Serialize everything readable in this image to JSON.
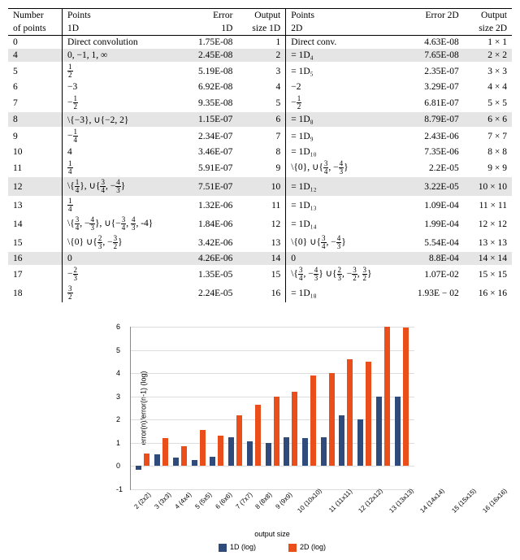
{
  "table": {
    "headers": {
      "c1a": "Number",
      "c1b": "of points",
      "c2": "Points",
      "c2b": "1D",
      "c3": "Error",
      "c3b": "1D",
      "c4": "Output",
      "c4b": "size 1D",
      "c5": "Points",
      "c5b": "2D",
      "c6": "Error 2D",
      "c7": "Output",
      "c7b": "size 2D"
    },
    "rows": [
      {
        "n": "0",
        "p1d": "Direct convolution",
        "e1d": "1.75E-08",
        "o1d": "1",
        "p2d": "Direct conv.",
        "e2d": "4.63E-08",
        "o2d": "1 × 1",
        "shade": false
      },
      {
        "n": "4",
        "p1d": "0, −1, 1, ∞",
        "e1d": "2.45E-08",
        "o1d": "2",
        "p2d": "= 1D₄",
        "e2d": "7.65E-08",
        "o2d": "2 × 2",
        "shade": true
      },
      {
        "n": "5",
        "p1d": "f:1/2",
        "e1d": "5.19E-08",
        "o1d": "3",
        "p2d": "= 1D₅",
        "e2d": "2.35E-07",
        "o2d": "3 × 3",
        "shade": false
      },
      {
        "n": "6",
        "p1d": "−3",
        "e1d": "6.92E-08",
        "o1d": "4",
        "p2d": "−2",
        "e2d": "3.29E-07",
        "o2d": "4 × 4",
        "shade": false
      },
      {
        "n": "7",
        "p1d": "f:-1/2",
        "e1d": "9.35E-08",
        "o1d": "5",
        "p2d": "f:-1/2",
        "e2d": "6.81E-07",
        "o2d": "5 × 5",
        "shade": false
      },
      {
        "n": "8",
        "p1d": "\\{−3}, ∪{−2, 2}",
        "e1d": "1.15E-07",
        "o1d": "6",
        "p2d": "= 1D₈",
        "e2d": "8.79E-07",
        "o2d": "6 × 6",
        "shade": true
      },
      {
        "n": "9",
        "p1d": "f:-1/4",
        "e1d": "2.34E-07",
        "o1d": "7",
        "p2d": "= 1D₉",
        "e2d": "2.43E-06",
        "o2d": "7 × 7",
        "shade": false
      },
      {
        "n": "10",
        "p1d": "4",
        "e1d": "3.46E-07",
        "o1d": "8",
        "p2d": "= 1D₁₀",
        "e2d": "7.35E-06",
        "o2d": "8 × 8",
        "shade": false
      },
      {
        "n": "11",
        "p1d": "f:1/4",
        "e1d": "5.91E-07",
        "o1d": "9",
        "p2d": "s:\\{0}, ∪{3/4, -4/3}",
        "e2d": "2.2E-05",
        "o2d": "9 × 9",
        "shade": false
      },
      {
        "n": "12",
        "p1d": "s:\\{1/4}, ∪{3/4, -4/3}",
        "e1d": "7.51E-07",
        "o1d": "10",
        "p2d": "= 1D₁₂",
        "e2d": "3.22E-05",
        "o2d": "10 × 10",
        "shade": true
      },
      {
        "n": "13",
        "p1d": "f:1/4",
        "e1d": "1.32E-06",
        "o1d": "11",
        "p2d": "= 1D₁₃",
        "e2d": "1.09E-04",
        "o2d": "11 × 11",
        "shade": false
      },
      {
        "n": "14",
        "p1d": "s:\\{3/4, -4/3}, ∪{-3/4, 4/3, -4}",
        "e1d": "1.84E-06",
        "o1d": "12",
        "p2d": "= 1D₁₄",
        "e2d": "1.99E-04",
        "o2d": "12 × 12",
        "shade": false
      },
      {
        "n": "15",
        "p1d": "s:\\{0} ∪{2/3, -3/2}",
        "e1d": "3.42E-06",
        "o1d": "13",
        "p2d": "s:\\{0} ∪{3/4, -4/3}",
        "e2d": "5.54E-04",
        "o2d": "13 × 13",
        "shade": false
      },
      {
        "n": "16",
        "p1d": "0",
        "e1d": "4.26E-06",
        "o1d": "14",
        "p2d": "0",
        "e2d": "8.8E-04",
        "o2d": "14 × 14",
        "shade": true
      },
      {
        "n": "17",
        "p1d": "f:-2/3",
        "e1d": "1.35E-05",
        "o1d": "15",
        "p2d": "s:\\{3/4, -4/3} ∪{2/3, -3/2, 3/2}",
        "e2d": "1.07E-02",
        "o2d": "15 × 15",
        "shade": false
      },
      {
        "n": "18",
        "p1d": "f:3/2",
        "e1d": "2.24E-05",
        "o1d": "16",
        "p2d": "= 1D₁₈",
        "e2d": "1.93E − 02",
        "o2d": "16 × 16",
        "shade": false
      }
    ]
  },
  "chart_data": {
    "type": "bar",
    "title": "",
    "xlabel": "output size",
    "ylabel": "error(n)/error(n-1) (log)",
    "ylim": [
      -1,
      6
    ],
    "categories": [
      "2 (2x2)",
      "3 (3x3)",
      "4 (4x4)",
      "5 (5x5)",
      "6 (6x6)",
      "7 (7x7)",
      "8 (8x8)",
      "9 (9x9)",
      "10 (10x10)",
      "11 (11x11)",
      "12 (12x12)",
      "13 (13x13)",
      "14 (14x14)",
      "15 (15x15)",
      "16 (16x16)"
    ],
    "series": [
      {
        "name": "1D (log)",
        "color": "#2f4b7c",
        "values": [
          -0.15,
          0.5,
          0.35,
          0.25,
          0.4,
          1.25,
          1.05,
          1.0,
          1.25,
          1.2,
          1.25,
          2.2,
          2.0,
          3.0,
          3.0
        ]
      },
      {
        "name": "2D (log)",
        "color": "#e94e1b",
        "values": [
          0.55,
          1.2,
          0.85,
          1.55,
          1.3,
          2.2,
          2.65,
          3.0,
          3.2,
          3.9,
          4.0,
          4.6,
          4.5,
          6.0,
          5.95
        ]
      }
    ]
  },
  "legend": {
    "l1": "1D (log)",
    "l2": "2D (log)"
  }
}
